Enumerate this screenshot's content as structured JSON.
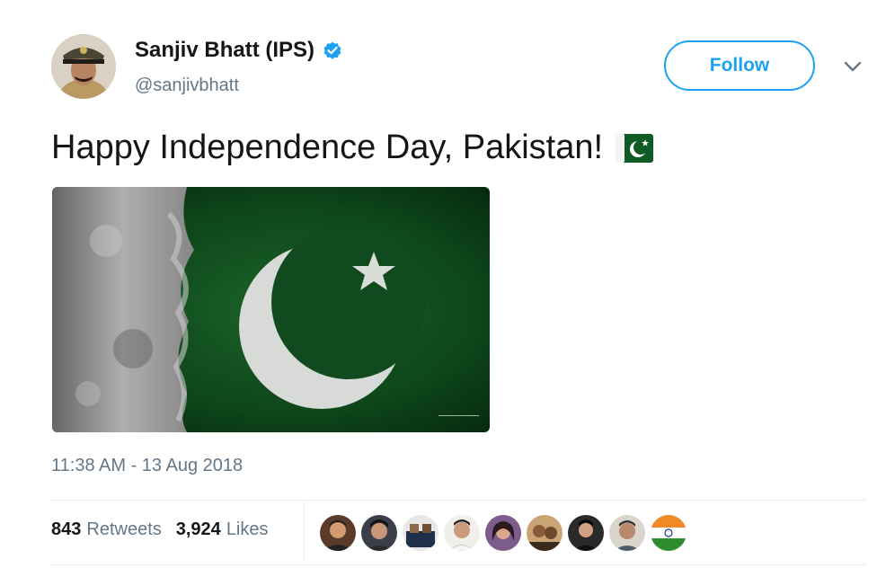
{
  "author": {
    "name": "Sanjiv Bhatt (IPS)",
    "handle": "@sanjivbhatt",
    "verified": true,
    "avatar_icon": "avatar-police-officer"
  },
  "header": {
    "follow_label": "Follow",
    "menu_icon": "chevron-down-icon"
  },
  "tweet": {
    "text": "Happy Independence Day, Pakistan!",
    "emoji_icon": "pakistan-flag-emoji",
    "media_icon": "pakistan-flag-image"
  },
  "meta": {
    "timestamp": "11:38 AM - 13 Aug 2018"
  },
  "stats": {
    "retweets_count": "843",
    "retweets_label": "Retweets",
    "likes_count": "3,924",
    "likes_label": "Likes"
  },
  "likers": [
    "liker-avatar-1",
    "liker-avatar-2",
    "liker-avatar-3",
    "liker-avatar-4",
    "liker-avatar-5",
    "liker-avatar-6",
    "liker-avatar-7",
    "liker-avatar-8",
    "liker-avatar-9"
  ],
  "colors": {
    "accent": "#1da1f2",
    "secondary_text": "#657786",
    "flag_green": "#0b4d1e"
  }
}
